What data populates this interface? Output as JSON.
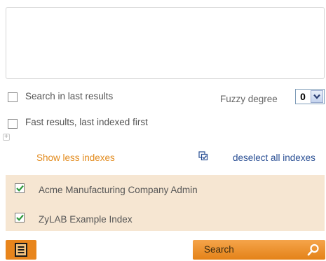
{
  "search": {
    "query_value": "",
    "in_last_results_label": "Search in last results",
    "in_last_results_checked": false,
    "fast_results_label": "Fast results, last indexed first",
    "fast_results_checked": false,
    "fuzzy_label": "Fuzzy degree",
    "fuzzy_value": "0"
  },
  "indexes": {
    "expand_glyph": "+",
    "show_less_label": "Show less indexes",
    "deselect_all_label": "deselect all indexes",
    "items": [
      {
        "label": "Acme Manufacturing Company Admin",
        "checked": true
      },
      {
        "label": "ZyLAB Example Index",
        "checked": true
      }
    ]
  },
  "actions": {
    "search_label": "Search"
  },
  "colors": {
    "accent_orange": "#e8851c",
    "panel_background": "#f6e6d2",
    "link_blue": "#2a4f94",
    "check_green": "#2e9a3c"
  }
}
